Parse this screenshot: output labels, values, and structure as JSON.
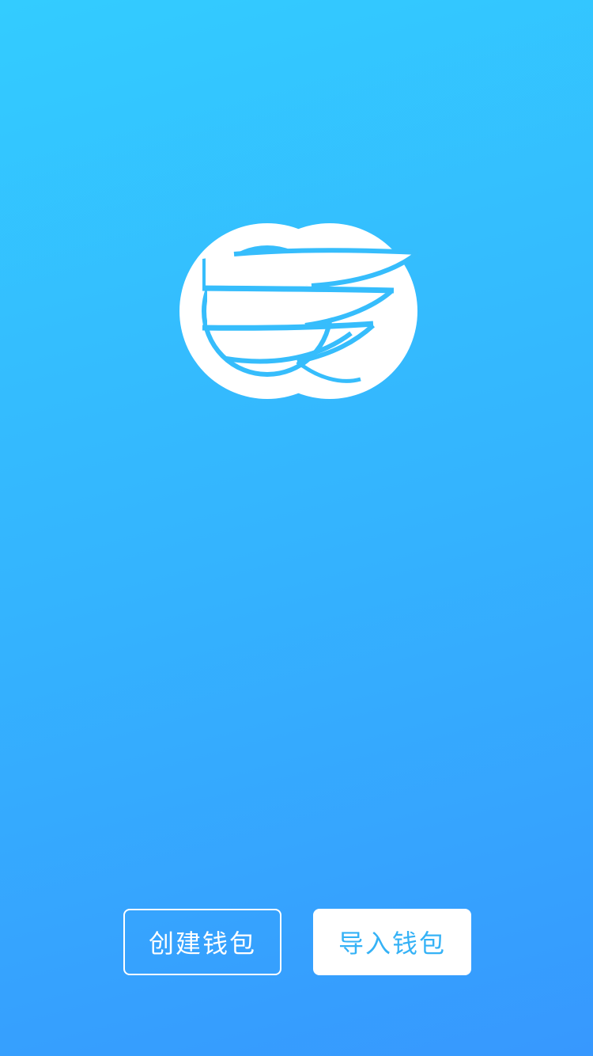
{
  "app": {
    "logo_icon": "wing-coin-logo-icon"
  },
  "actions": {
    "create_wallet_label": "创建钱包",
    "import_wallet_label": "导入钱包"
  },
  "colors": {
    "gradient_top": "#33ccff",
    "gradient_bottom": "#3798fe",
    "accent": "#35b2f6",
    "logo_fill": "#ffffff"
  }
}
